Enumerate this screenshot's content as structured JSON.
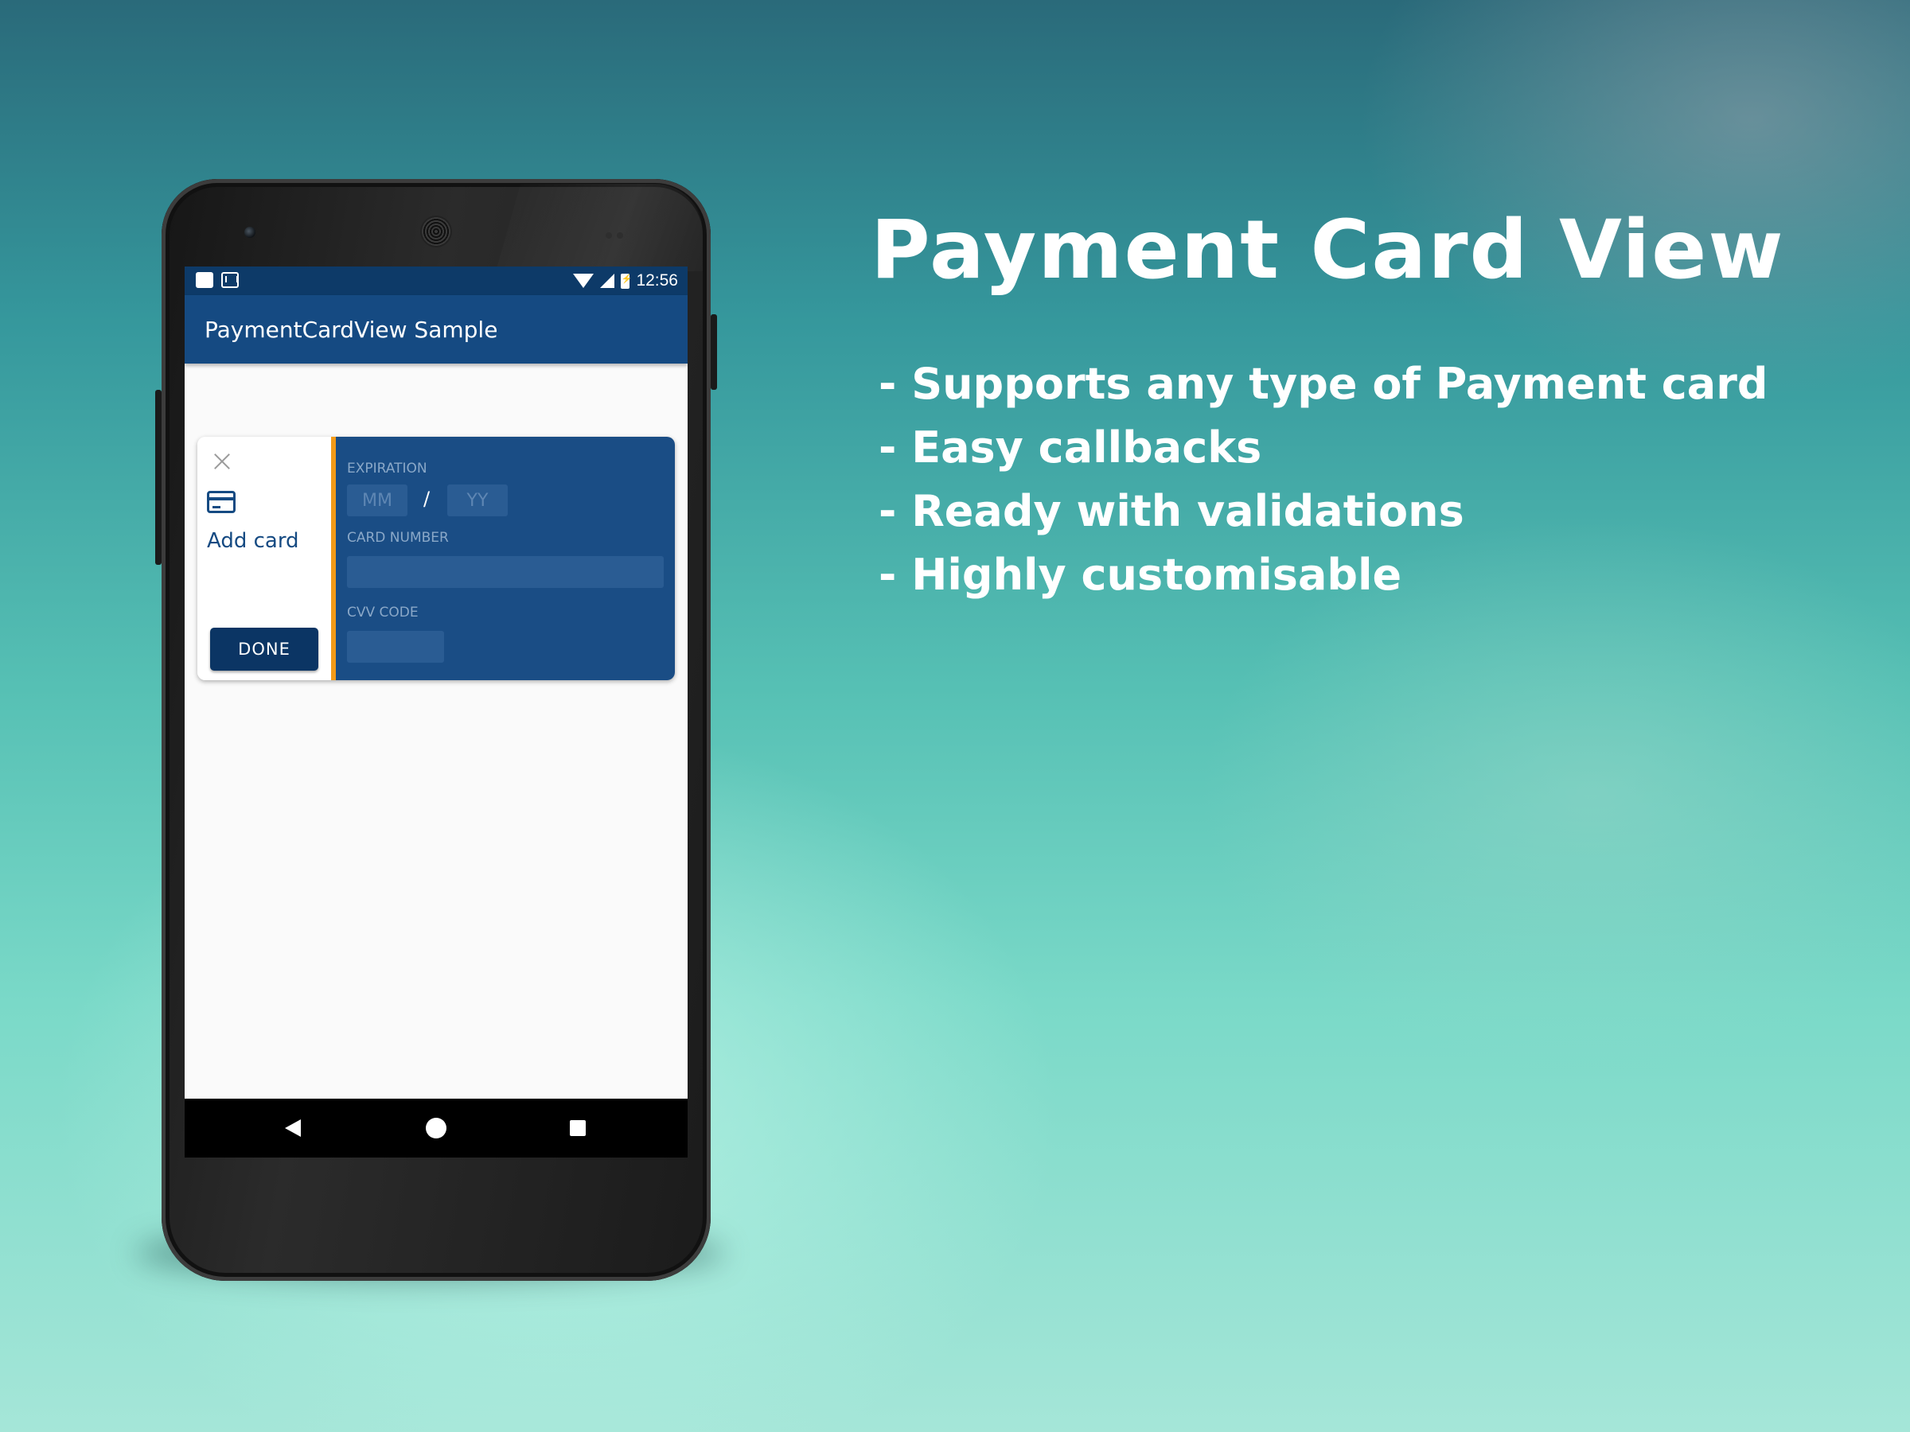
{
  "headline": "Payment Card View",
  "features": [
    "- Supports any type of Payment card",
    "- Easy callbacks",
    "- Ready with validations",
    "- Highly customisable"
  ],
  "phone": {
    "status_bar": {
      "time": "12:56",
      "icons": [
        "notification-icon",
        "mail-icon",
        "wifi-icon",
        "signal-icon",
        "battery-icon"
      ]
    },
    "app_bar": {
      "title": "PaymentCardView Sample"
    },
    "card": {
      "add_card_label": "Add card",
      "done_label": "DONE",
      "expiration": {
        "label": "EXPIRATION",
        "month_placeholder": "MM",
        "separator": "/",
        "year_placeholder": "YY"
      },
      "card_number": {
        "label": "CARD NUMBER",
        "value": ""
      },
      "cvv": {
        "label": "CVV CODE",
        "value": ""
      }
    },
    "nav_bar": [
      "back-icon",
      "home-icon",
      "recents-icon"
    ]
  },
  "colors": {
    "primary": "#154a82",
    "primary_dark": "#0d3a68",
    "accent": "#f39b19",
    "card_panel": "#1a4d85"
  }
}
